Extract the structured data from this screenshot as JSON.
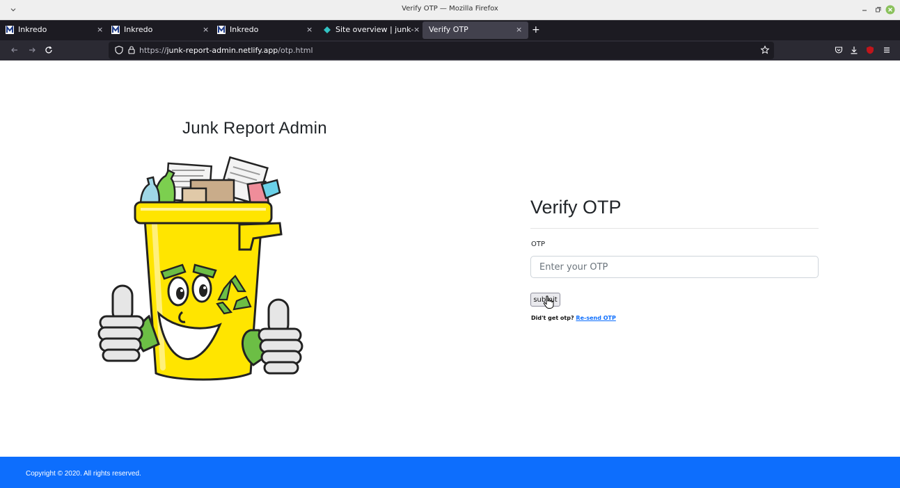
{
  "window": {
    "title": "Verify OTP — Mozilla Firefox"
  },
  "tabs": [
    {
      "label": "Inkredo",
      "icon": "inkredo-favicon-icon",
      "active": false
    },
    {
      "label": "Inkredo",
      "icon": "inkredo-favicon-icon",
      "active": false
    },
    {
      "label": "Inkredo",
      "icon": "inkredo-favicon-icon",
      "active": false
    },
    {
      "label": "Site overview | junk-rep",
      "icon": "netlify-favicon-icon",
      "active": false
    },
    {
      "label": "Verify OTP",
      "icon": "",
      "active": true
    }
  ],
  "newtab_label": "+",
  "tab_close_glyph": "×",
  "navbar": {
    "url_scheme": "https://",
    "url_host": "junk-report-admin.netlify.app",
    "url_path": "/otp.html"
  },
  "page": {
    "brand_title": "Junk Report Admin",
    "form_title": "Verify OTP",
    "otp_label": "OTP",
    "otp_placeholder": "Enter your OTP",
    "otp_value": "",
    "submit_label": "submit",
    "resend_prompt": "Did't get otp?",
    "resend_link": "Re-send OTP"
  },
  "footer": {
    "copyright": "Copyright © 2020. All rights reserved."
  },
  "colors": {
    "accent": "#0d6efd",
    "tabstrip": "#1c1b22",
    "navbar": "#2b2a33",
    "mascot_yellow": "#ffe500",
    "mascot_green": "#6cbe45"
  }
}
